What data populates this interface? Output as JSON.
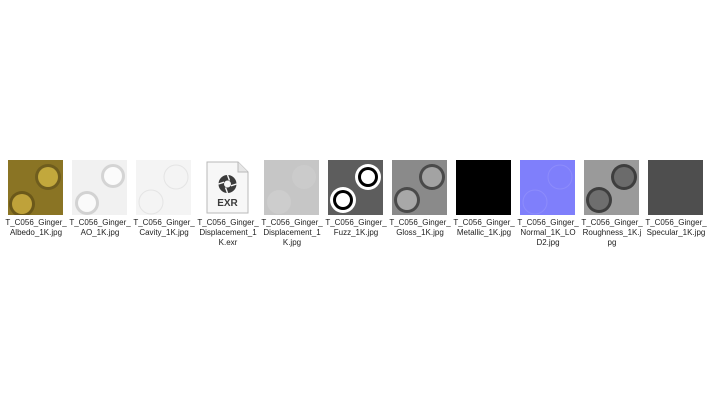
{
  "files": [
    {
      "name": "T_C056_Ginger_Albedo_1K.jpg",
      "line1": "T_C056_Ginger_",
      "line2": "Albedo_1K.jpg",
      "line3": "",
      "thumb": "albedo"
    },
    {
      "name": "T_C056_Ginger_AO_1K.jpg",
      "line1": "T_C056_Ginger_",
      "line2": "AO_1K.jpg",
      "line3": "",
      "thumb": "ao"
    },
    {
      "name": "T_C056_Ginger_Cavity_1K.jpg",
      "line1": "T_C056_Ginger_",
      "line2": "Cavity_1K.jpg",
      "line3": "",
      "thumb": "cavity"
    },
    {
      "name": "T_C056_Ginger_Displacement_1K.exr",
      "line1": "T_C056_Ginger_",
      "line2": "Displacement_1",
      "line3": "K.exr",
      "thumb": "exr",
      "badge": "EXR"
    },
    {
      "name": "T_C056_Ginger_Displacement_1K.jpg",
      "line1": "T_C056_Ginger_",
      "line2": "Displacement_1",
      "line3": "K.jpg",
      "thumb": "displacement"
    },
    {
      "name": "T_C056_Ginger_Fuzz_1K.jpg",
      "line1": "T_C056_Ginger_",
      "line2": "Fuzz_1K.jpg",
      "line3": "",
      "thumb": "fuzz"
    },
    {
      "name": "T_C056_Ginger_Gloss_1K.jpg",
      "line1": "T_C056_Ginger_",
      "line2": "Gloss_1K.jpg",
      "line3": "",
      "thumb": "gloss"
    },
    {
      "name": "T_C056_Ginger_Metallic_1K.jpg",
      "line1": "T_C056_Ginger_",
      "line2": "Metallic_1K.jpg",
      "line3": "",
      "thumb": "metallic"
    },
    {
      "name": "T_C056_Ginger_Normal_1K_LOD2.jpg",
      "line1": "T_C056_Ginger_",
      "line2": "Normal_1K_LO",
      "line3": "D2.jpg",
      "thumb": "normal"
    },
    {
      "name": "T_C056_Ginger_Roughness_1K.jpg",
      "line1": "T_C056_Ginger_",
      "line2": "Roughness_1K.j",
      "line3": "pg",
      "thumb": "roughness"
    },
    {
      "name": "T_C056_Ginger_Specular_1K.jpg",
      "line1": "T_C056_Ginger_",
      "line2": "Specular_1K.jpg",
      "line3": "",
      "thumb": "specular"
    }
  ],
  "colors": {
    "albedo_bg": "#8a7424",
    "normal_bg": "#7f7ffb",
    "metallic_bg": "#000000",
    "specular_bg": "#4e4e4e"
  }
}
